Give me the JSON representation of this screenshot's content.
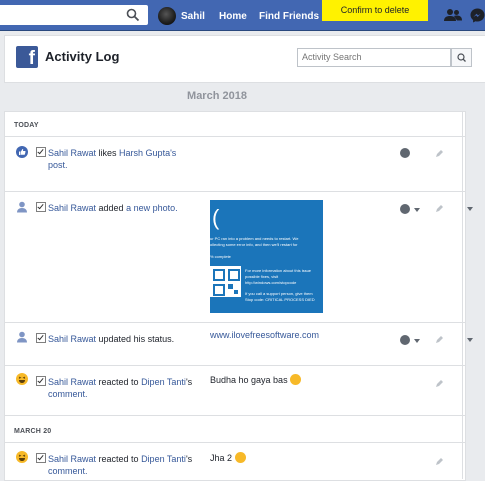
{
  "topbar": {
    "search_value": "",
    "profile_name": "Sahil",
    "home_label": "Home",
    "find_friends_label": "Find Friends",
    "confirm_note": "Confirm to delete"
  },
  "header": {
    "logo_letter": "f",
    "title": "Activity Log",
    "search_placeholder": "Activity Search"
  },
  "month_label": "March 2018",
  "sections": [
    {
      "label": "TODAY"
    },
    {
      "label": "MARCH 20"
    }
  ],
  "entries": [
    {
      "actor": "Sahil Rawat",
      "verb": " likes ",
      "target": "Harsh Gupta's",
      "tail": "post.",
      "icon": "like-icon"
    },
    {
      "actor": "Sahil Rawat",
      "verb": " added ",
      "target": "a new photo.",
      "icon": "person-icon"
    },
    {
      "actor": "Sahil Rawat",
      "verb": " updated his status.",
      "content": "www.ilovefreesoftware.com",
      "icon": "person-icon"
    },
    {
      "actor": "Sahil Rawat",
      "verb": " reacted to ",
      "target": "Dipen Tanti",
      "tail_mid": "'s",
      "tail": "comment.",
      "content": "Budha ho gaya bas",
      "icon": "haha-icon"
    },
    {
      "actor": "Sahil Rawat",
      "verb": " reacted to ",
      "target": "Dipen Tanti",
      "tail_mid": "'s",
      "tail": "comment.",
      "content": "Jha 2",
      "icon": "haha-icon"
    }
  ],
  "photo_text": {
    "line1": "ur PC ran into a problem and needs to restart. We",
    "line2": "ollecting some error info, and then we'll restart for",
    "line3": "% complete",
    "line4": "For more information about this issue",
    "line5": "possible fixes, visit",
    "line6": "http://windows.com/stopcode",
    "line7": "If you call a support person, give them",
    "line8": "Stop code: CRITICAL PROCESS DIED"
  },
  "colors": {
    "bar": "#4267b2",
    "link": "#365899",
    "highlight": "#fff200",
    "bsod": "#1b75ba"
  }
}
